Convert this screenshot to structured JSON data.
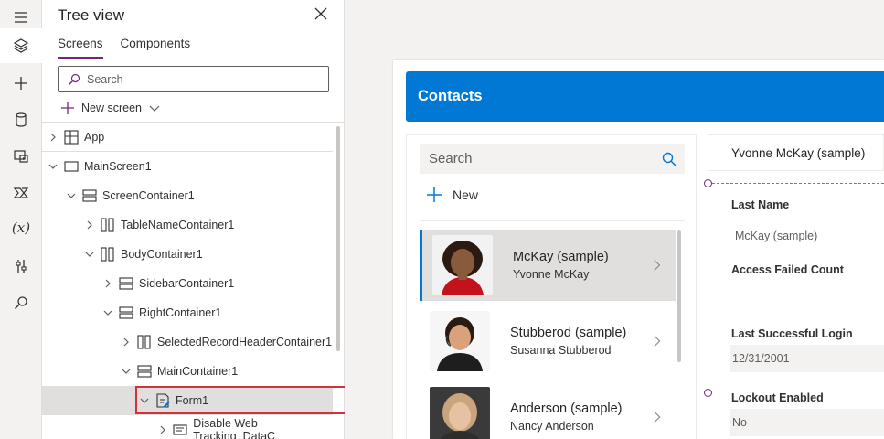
{
  "tree_panel": {
    "title": "Tree view",
    "tabs": [
      {
        "label": "Screens",
        "active": true
      },
      {
        "label": "Components",
        "active": false
      }
    ],
    "search_placeholder": "Search",
    "new_screen_label": "New screen",
    "nodes": [
      {
        "label": "App",
        "level": 0,
        "expanded": false,
        "icon": "app-icon"
      },
      {
        "label": "MainScreen1",
        "level": 0,
        "expanded": true,
        "icon": "screen-icon"
      },
      {
        "label": "ScreenContainer1",
        "level": 1,
        "expanded": true,
        "icon": "vertical-container-icon"
      },
      {
        "label": "TableNameContainer1",
        "level": 2,
        "expanded": false,
        "icon": "horizontal-container-icon"
      },
      {
        "label": "BodyContainer1",
        "level": 2,
        "expanded": true,
        "icon": "horizontal-container-icon"
      },
      {
        "label": "SidebarContainer1",
        "level": 3,
        "expanded": false,
        "icon": "vertical-container-icon"
      },
      {
        "label": "RightContainer1",
        "level": 3,
        "expanded": true,
        "icon": "vertical-container-icon"
      },
      {
        "label": "SelectedRecordHeaderContainer1",
        "level": 4,
        "expanded": false,
        "icon": "horizontal-container-icon"
      },
      {
        "label": "MainContainer1",
        "level": 4,
        "expanded": true,
        "icon": "vertical-container-icon"
      },
      {
        "label": "Form1",
        "level": 5,
        "expanded": true,
        "icon": "form-icon",
        "selected": true
      },
      {
        "label": "Disable Web Tracking_DataC",
        "level": 6,
        "expanded": false,
        "icon": "card-icon"
      }
    ]
  },
  "app_preview": {
    "header_title": "Contacts",
    "search_placeholder": "Search",
    "new_label": "New",
    "contacts": [
      {
        "name": "McKay (sample)",
        "full_name": "Yvonne McKay",
        "selected": true
      },
      {
        "name": "Stubberod (sample)",
        "full_name": "Susanna Stubberod",
        "selected": false
      },
      {
        "name": "Anderson (sample)",
        "full_name": "Nancy Anderson",
        "selected": false
      }
    ],
    "selected_record_title": "Yvonne McKay (sample)",
    "form_fields": [
      {
        "label": "Last Name",
        "value": "McKay (sample)"
      },
      {
        "label": "Access Failed Count",
        "value": ""
      },
      {
        "label": "Last Successful Login",
        "value": "12/31/2001"
      },
      {
        "label": "Lockout Enabled",
        "value": "No"
      }
    ]
  },
  "colors": {
    "header_blue": "#0078d4",
    "accent_purple": "#742774",
    "highlight_red": "#d13438"
  }
}
